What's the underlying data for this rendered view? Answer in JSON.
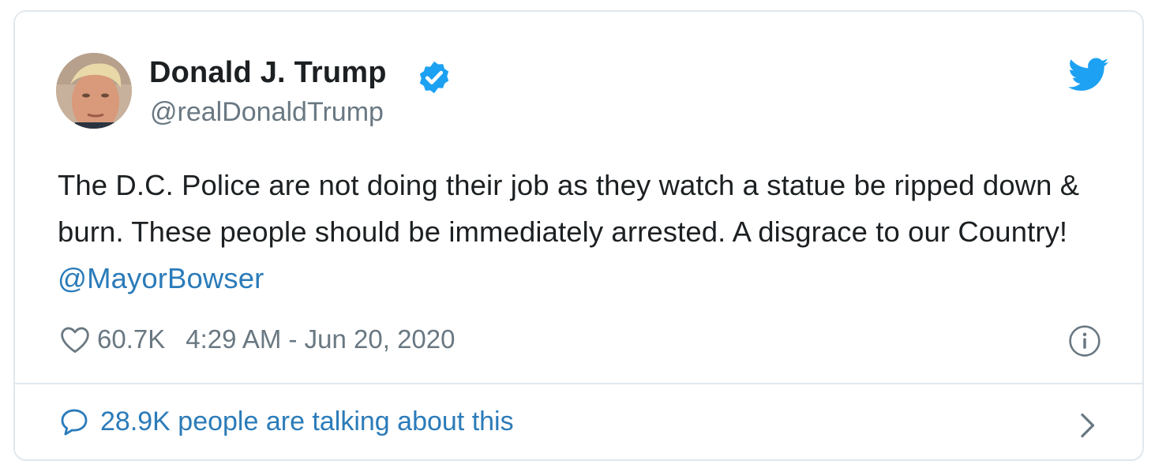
{
  "tweet": {
    "author_name": "Donald J. Trump",
    "author_handle": "@realDonaldTrump",
    "text": "The D.C. Police are not doing their job as they watch a statue be ripped down & burn. These people should be immediately arrested. A disgrace to our Country!",
    "mention": "@MayorBowser",
    "likes": "60.7K",
    "timestamp": "4:29 AM - Jun 20, 2020",
    "talking": "28.9K people are talking about this"
  },
  "icons": {
    "avatar": "profile-photo",
    "verified": "verified-badge-icon",
    "logo": "twitter-bird-icon",
    "like": "heart-icon",
    "info": "info-icon",
    "reply": "speech-bubble-icon",
    "chevron": "chevron-right-icon"
  },
  "colors": {
    "brand": "#1da1f2",
    "link": "#2b7bb9",
    "text": "#1c2022",
    "secondary": "#697882",
    "border": "#e1e8ed"
  }
}
